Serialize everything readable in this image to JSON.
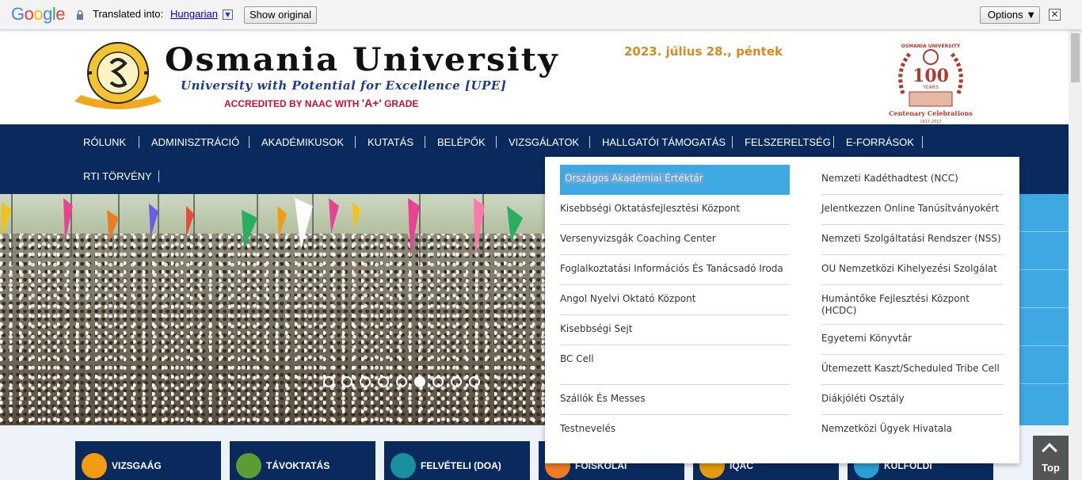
{
  "translate_bar": {
    "logo": "Google",
    "label": "Translated into:",
    "language": "Hungarian",
    "show_original": "Show original",
    "options": "Options ▼",
    "close": "✕"
  },
  "header": {
    "title": "Osmania University",
    "motto": "University with Potential for Excellence [UPE]",
    "accreditation_pre": "ACCREDITED BY NAAC WITH ",
    "accreditation_grade": "'A+'",
    "accreditation_post": " GRADE",
    "date": "2023. július 28., péntek",
    "centenary_top": "OSMANIA UNIVERSITY",
    "centenary_number": "100",
    "centenary_years": "YEARS",
    "centenary_label": "Centenary Celebrations",
    "centenary_range": "1917-2017"
  },
  "nav": {
    "items": [
      "RÓLUNK",
      "ADMINISZTRÁCIÓ",
      "AKADÉMIKUSOK",
      "KUTATÁS",
      "BELÉPŐK",
      "VIZSGÁLATOK",
      "HALLGATÓI TÁMOGATÁS",
      "FELSZERELTSÉG",
      "E-FORRÁSOK",
      "RTI TÖRVÉNY"
    ]
  },
  "dropdown": {
    "left": [
      "Országos Akadémiai Értéktár",
      "Kisebbségi Oktatásfejlesztési Központ",
      "Versenyvizsgák Coaching Center",
      "Foglalkoztatási Információs És Tanácsadó Iroda",
      "Angol Nyelvi Oktató Központ",
      "Kisebbségi Sejt",
      "BC Cell",
      "Szállók És Messes",
      "Testnevelés"
    ],
    "right": [
      "Nemzeti Kadéthadtest (NCC)",
      "Jelentkezzen Online Tanúsítványokért",
      "Nemzeti Szolgáltatási Rendszer (NSS)",
      "OU Nemzetközi Kihelyezési Szolgálat",
      "Humántőke Fejlesztési Központ (HCDC)",
      "Egyetemi Könyvtár",
      "Ütemezett Kaszt/Scheduled Tribe Cell",
      "Diákjóléti Osztály",
      "Nemzetközi Ügyek Hivatala"
    ]
  },
  "slider": {
    "dot_count": 9,
    "active_index": 5
  },
  "quick_links": [
    "VIZSGAÁG",
    "TÁVOKTATÁS",
    "FELVÉTELI (DOA)",
    "FOISKOLAI",
    "IQAC",
    "KULFOLDI"
  ],
  "top_button": {
    "label": "Top"
  },
  "colors": {
    "nav_bg": "#0a2a5e",
    "highlight": "#3ea8e2",
    "date": "#d98a1e",
    "accreditation": "#c8102e"
  }
}
